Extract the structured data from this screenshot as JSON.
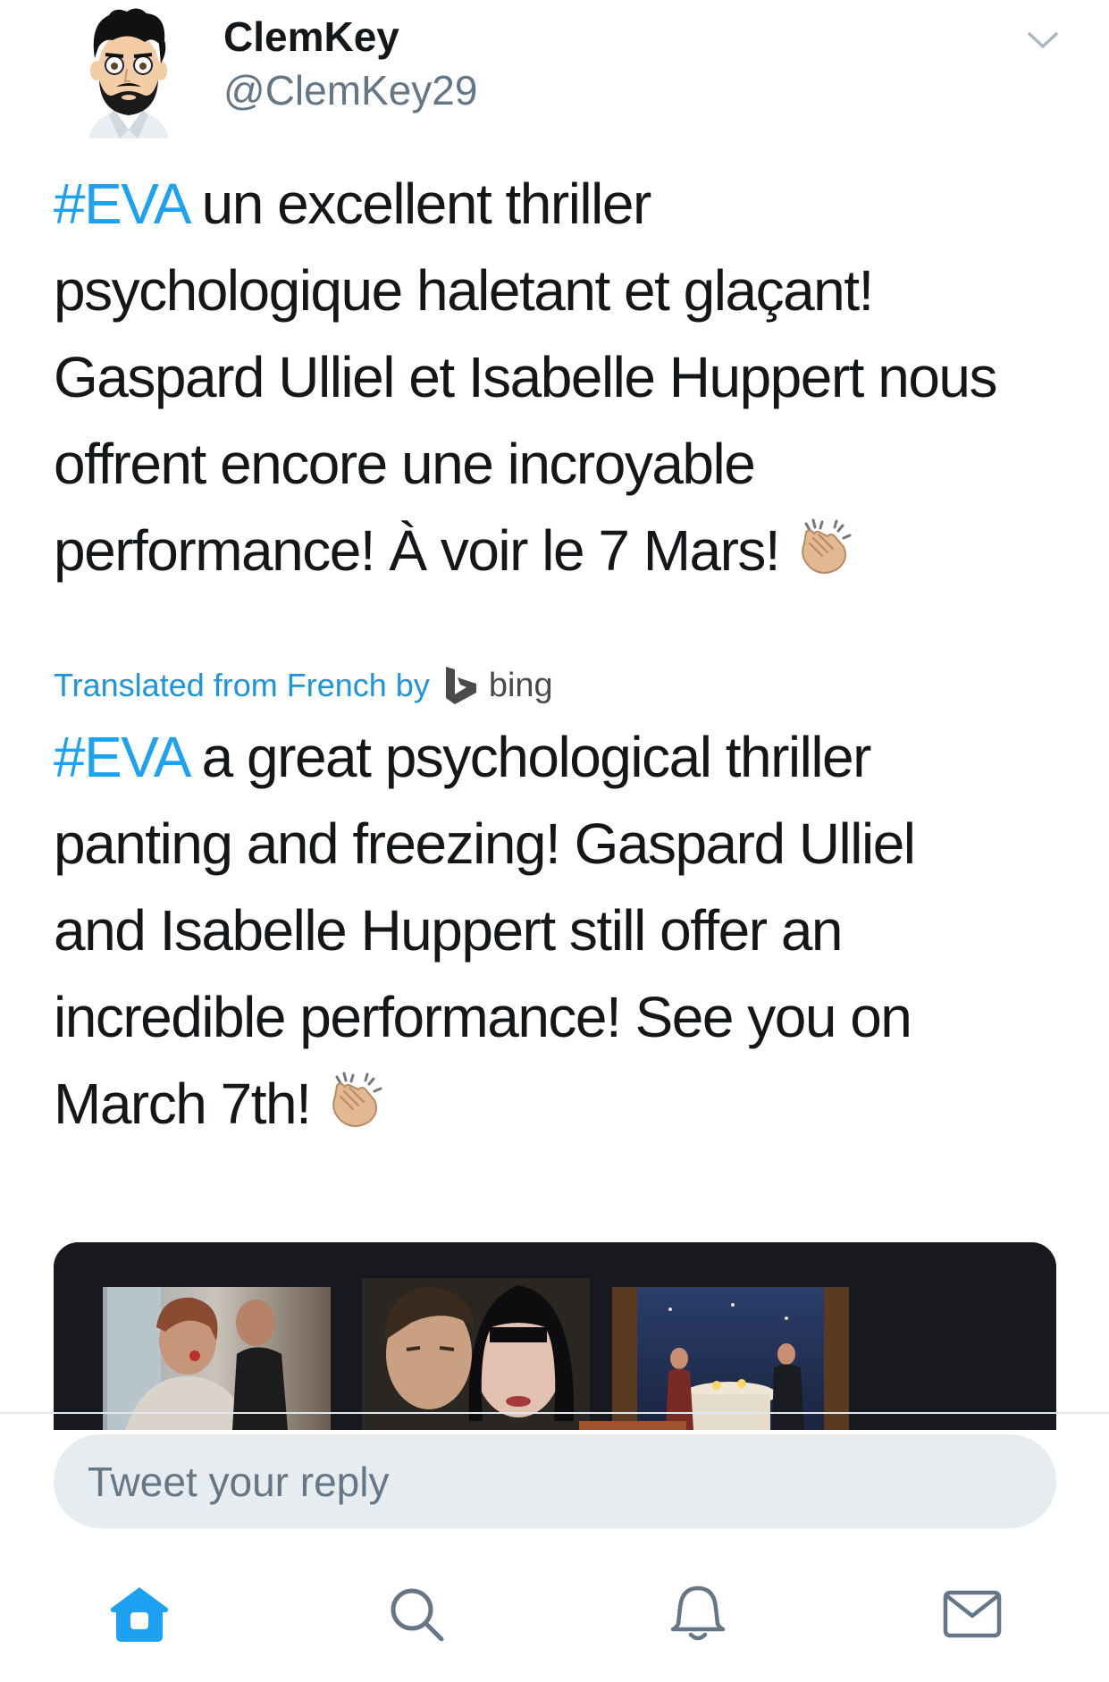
{
  "header": {
    "display_name": "ClemKey",
    "handle": "@ClemKey29"
  },
  "tweet": {
    "original": {
      "lines": [
        {
          "hashtag": "#EVA",
          "text": " un excellent thriller"
        },
        {
          "text": "psychologique haletant et glaçant!"
        },
        {
          "text": "Gaspard Ulliel et Isabelle Huppert nous"
        },
        {
          "text": "offrent encore une incroyable"
        },
        {
          "text": "performance! À voir le 7 Mars!"
        }
      ],
      "emoji": "clapping-hands-icon"
    },
    "translation": {
      "label": "Translated from French by",
      "provider": "bing"
    },
    "translated": {
      "lines": [
        {
          "hashtag": "#EVA",
          "text": " a great psychological thriller"
        },
        {
          "text": "panting and freezing! Gaspard Ulliel"
        },
        {
          "text": "and Isabelle Huppert still offer an"
        },
        {
          "text": "incredible performance! See you on"
        },
        {
          "text": "March 7th!"
        }
      ],
      "emoji": "clapping-hands-icon"
    }
  },
  "reply": {
    "placeholder": "Tweet your reply"
  },
  "colors": {
    "accent": "#1da1f2",
    "secondary_text": "#657786",
    "reply_bg": "#e6ecf0"
  }
}
